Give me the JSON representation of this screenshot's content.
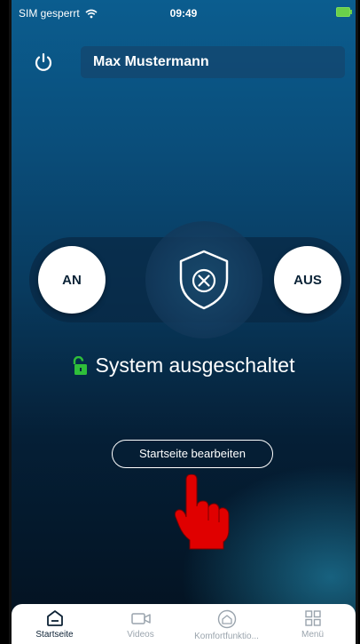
{
  "statusbar": {
    "carrier": "SIM gesperrt",
    "time": "09:49",
    "battery_color": "#6ad04a"
  },
  "header": {
    "power_icon": "power-icon",
    "user_name": "Max Mustermann"
  },
  "arming": {
    "on_label": "AN",
    "off_label": "AUS",
    "shield_icon": "shield-x-icon"
  },
  "system_status": {
    "lock_icon": "unlocked-padlock-icon",
    "lock_color": "#2fbf3a",
    "text": "System ausgeschaltet"
  },
  "edit_button": {
    "label": "Startseite bearbeiten"
  },
  "pointer": {
    "icon": "pointing-hand-icon",
    "color": "#e00000"
  },
  "tabbar": {
    "tabs": [
      {
        "label": "Startseite",
        "icon": "home-icon",
        "active": true
      },
      {
        "label": "Videos",
        "icon": "video-camera-icon",
        "active": false
      },
      {
        "label": "Komfortfunktio...",
        "icon": "comfort-icon",
        "active": false
      },
      {
        "label": "Menü",
        "icon": "grid-menu-icon",
        "active": false
      }
    ]
  }
}
